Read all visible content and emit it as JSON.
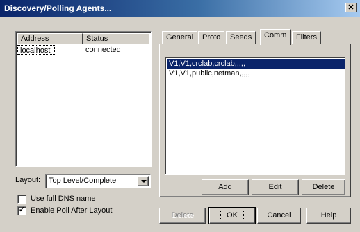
{
  "window": {
    "title": "Discovery/Polling Agents...",
    "close_glyph": "✕"
  },
  "agents": {
    "columns": [
      "Address",
      "Status"
    ],
    "rows": [
      {
        "address": "localhost",
        "status": "connected"
      }
    ]
  },
  "layout": {
    "label": "Layout:",
    "value": "Top Level/Complete"
  },
  "options": {
    "full_dns": {
      "label": "Use full DNS name",
      "checked": false
    },
    "poll_after": {
      "label": "Enable Poll After Layout",
      "checked": true
    }
  },
  "tabs": [
    "General",
    "Proto",
    "Seeds",
    "Comm",
    "Filters"
  ],
  "active_tab": "Comm",
  "comm": {
    "entries": [
      "V1,V1,crclab,crclab,,,,,",
      "V1,V1,public,netman,,,,,"
    ],
    "selected_index": 0,
    "buttons": {
      "add": "Add",
      "edit": "Edit",
      "delete": "Delete"
    }
  },
  "footer": {
    "delete": "Delete",
    "ok": "OK",
    "cancel": "Cancel",
    "help": "Help"
  },
  "icons": {
    "checkbox_check": "check-icon",
    "combo_arrow": "chevron-down-icon",
    "close": "close-icon"
  }
}
